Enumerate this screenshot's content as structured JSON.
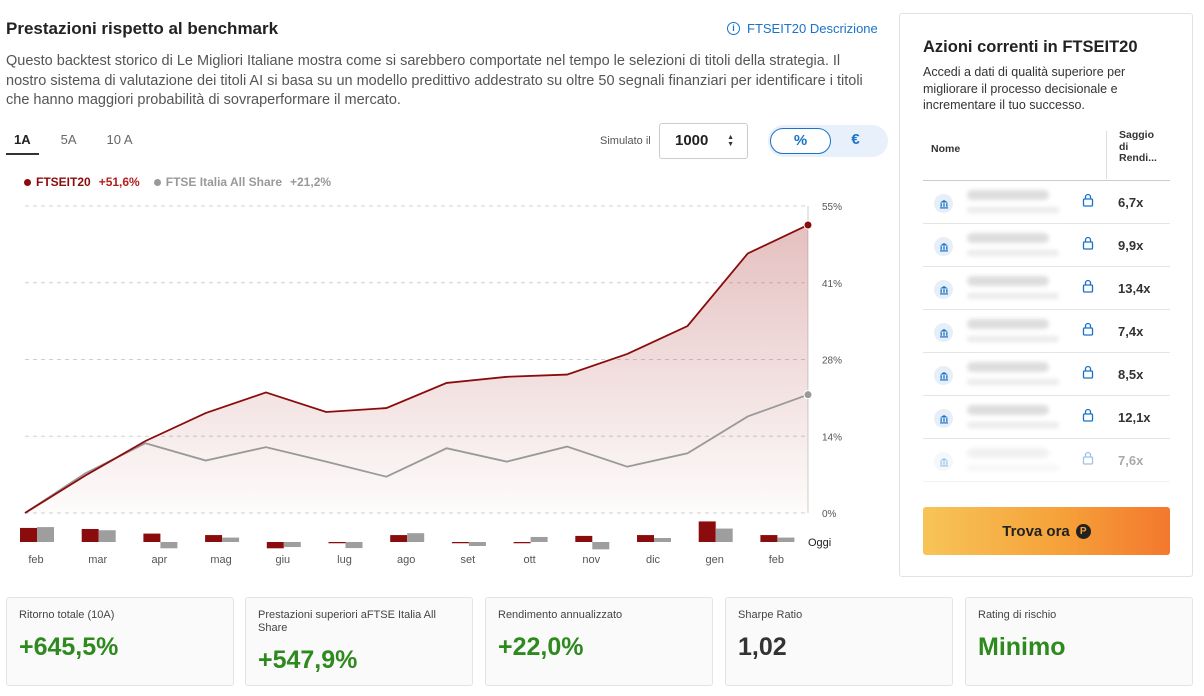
{
  "header": {
    "title": "Prestazioni rispetto al benchmark",
    "link_label": "FTSEIT20 Descrizione",
    "description": "Questo backtest storico di Le Migliori Italiane mostra come si sarebbero comportate nel tempo le selezioni di titoli della strategia. Il nostro sistema di valutazione dei titoli AI si basa su un modello predittivo addestrato su oltre 50 segnali finanziari per identificare i titoli che hanno maggiori probabilità di sovraperformare il mercato."
  },
  "controls": {
    "range_tabs": [
      {
        "label": "1A",
        "active": true
      },
      {
        "label": "5A",
        "active": false
      },
      {
        "label": "10 A",
        "active": false
      }
    ],
    "simulated_label": "Simulato il",
    "simulated_value": "1000",
    "unit_options": [
      "%",
      "€"
    ],
    "unit_selected": "%"
  },
  "legend": {
    "a_name": "FTSEIT20",
    "a_value": "+51,6%",
    "b_name": "FTSE Italia All Share",
    "b_value": "+21,2%"
  },
  "chart_data": {
    "type": "line",
    "title": "",
    "x": [
      "feb",
      "mar",
      "apr",
      "mag",
      "giu",
      "lug",
      "ago",
      "set",
      "ott",
      "nov",
      "dic",
      "gen",
      "feb",
      "Oggi"
    ],
    "y_ticks": [
      "55%",
      "41%",
      "28%",
      "14%",
      "0%"
    ],
    "ylim": [
      0,
      55
    ],
    "grid": true,
    "series": [
      {
        "name": "FTSEIT20",
        "color": "#8b0c0c",
        "values": [
          0,
          6.7,
          12.9,
          17.9,
          21.6,
          18.1,
          18.8,
          23.3,
          24.4,
          24.8,
          28.5,
          33.5,
          46.5,
          51.6
        ]
      },
      {
        "name": "FTSE Italia All Share",
        "color": "#999999",
        "values": [
          0,
          7.1,
          12.5,
          9.4,
          11.8,
          9.2,
          6.5,
          11.6,
          9.2,
          11.9,
          8.3,
          10.7,
          17.3,
          21.2
        ]
      }
    ],
    "monthly_bars": {
      "categories": [
        "feb",
        "mar",
        "apr",
        "mag",
        "giu",
        "lug",
        "ago",
        "set",
        "ott",
        "nov",
        "dic",
        "gen",
        "feb"
      ],
      "series": [
        {
          "name": "FTSEIT20",
          "color": "#8b0c0c",
          "values": [
            6.7,
            6.2,
            4.0,
            3.3,
            -3.0,
            -0.6,
            3.3,
            -0.6,
            -0.6,
            2.9,
            3.3,
            9.8,
            3.3
          ]
        },
        {
          "name": "FTSE Italia All Share",
          "color": "#9e9e9e",
          "values": [
            7.1,
            5.6,
            -3.0,
            2.1,
            -2.4,
            -2.9,
            4.2,
            -1.9,
            2.4,
            -3.5,
            1.9,
            6.4,
            2.1
          ]
        }
      ]
    }
  },
  "side": {
    "title": "Azioni correnti in FTSEIT20",
    "text": "Accedi a dati di qualità superiore per migliorare il processo decisionale e incrementare il tuo successo.",
    "col_name": "Nome",
    "col_yield": "Saggio di Rendi...",
    "rows": [
      {
        "value": "6,7x"
      },
      {
        "value": "9,9x"
      },
      {
        "value": "13,4x"
      },
      {
        "value": "7,4x"
      },
      {
        "value": "8,5x"
      },
      {
        "value": "12,1x"
      },
      {
        "value": "7,6x"
      }
    ],
    "cta_label": "Trova ora"
  },
  "stats": [
    {
      "label": "Ritorno totale (10A)",
      "value": "+645,5%"
    },
    {
      "label": "Prestazioni superiori aFTSE Italia All Share",
      "value": "+547,9%"
    },
    {
      "label": "Rendimento annualizzato",
      "value": "+22,0%"
    },
    {
      "label": "Sharpe Ratio",
      "value": "1,02"
    },
    {
      "label": "Rating di rischio",
      "value": "Minimo"
    }
  ]
}
